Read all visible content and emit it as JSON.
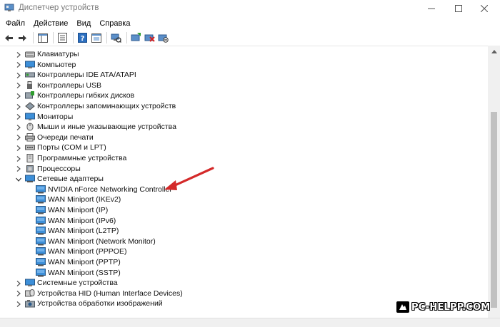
{
  "window": {
    "title": "Диспетчер устройств",
    "controls": [
      "minimize-icon",
      "maximize-icon",
      "close-icon"
    ]
  },
  "menu": [
    "Файл",
    "Действие",
    "Вид",
    "Справка"
  ],
  "toolbar": {
    "icons": [
      "back-arrow-icon",
      "forward-arrow-icon",
      "show-hide-tree-icon",
      "properties-icon",
      "help-icon",
      "show-devices-icon",
      "scan-hardware-icon",
      "update-driver-icon",
      "disable-device-icon",
      "uninstall-device-icon"
    ]
  },
  "tree": {
    "categories_top": [
      {
        "label": "Клавиатуры",
        "icon": "keyboard-icon"
      },
      {
        "label": "Компьютер",
        "icon": "computer-icon"
      },
      {
        "label": "Контроллеры IDE ATA/ATAPI",
        "icon": "ide-controller-icon"
      },
      {
        "label": "Контроллеры USB",
        "icon": "usb-icon"
      },
      {
        "label": "Контроллеры гибких дисков",
        "icon": "floppy-controller-icon"
      },
      {
        "label": "Контроллеры запоминающих устройств",
        "icon": "storage-controller-icon"
      },
      {
        "label": "Мониторы",
        "icon": "monitor-icon"
      },
      {
        "label": "Мыши и иные указывающие устройства",
        "icon": "mouse-icon"
      },
      {
        "label": "Очереди печати",
        "icon": "printer-icon"
      },
      {
        "label": "Порты (COM и LPT)",
        "icon": "port-icon"
      },
      {
        "label": "Программные устройства",
        "icon": "software-device-icon"
      },
      {
        "label": "Процессоры",
        "icon": "processor-icon"
      }
    ],
    "expanded_category": {
      "label": "Сетевые адаптеры",
      "icon": "network-adapter-icon",
      "expanded": true
    },
    "network_adapters": [
      "NVIDIA nForce Networking Controller",
      "WAN Miniport (IKEv2)",
      "WAN Miniport (IP)",
      "WAN Miniport (IPv6)",
      "WAN Miniport (L2TP)",
      "WAN Miniport (Network Monitor)",
      "WAN Miniport (PPPOE)",
      "WAN Miniport (PPTP)",
      "WAN Miniport (SSTP)"
    ],
    "categories_bottom": [
      {
        "label": "Системные устройства",
        "icon": "system-device-icon"
      },
      {
        "label": "Устройства HID (Human Interface Devices)",
        "icon": "hid-icon"
      },
      {
        "label": "Устройства обработки изображений",
        "icon": "imaging-device-icon"
      }
    ]
  },
  "annotation": {
    "arrow_color": "#d42a2a",
    "points_to": "NVIDIA nForce Networking Controller"
  },
  "watermark": {
    "text": "PC-HELPP.COM"
  },
  "colors": {
    "accent_blue": "#2f7fd1",
    "adapter_icon": "#3d8fd8"
  }
}
